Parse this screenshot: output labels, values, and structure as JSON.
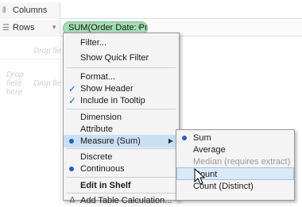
{
  "shelves": {
    "columns_label": "Columns",
    "rows_label": "Rows",
    "columns_icon": "columns-icon",
    "rows_icon": "rows-icon",
    "pill_label": "SUM(Order Date: Pr..",
    "pill_color": "#a6dcb6"
  },
  "view": {
    "drop_field_top": "Drop fie",
    "drop_field_left_1": "Drop",
    "drop_field_left_2": "field",
    "drop_field_left_3": "here",
    "drop_field_mid": "Drop fie"
  },
  "context_menu": {
    "items": [
      {
        "label": "Filter..."
      },
      {
        "label": "Show Quick Filter"
      },
      {
        "label": "Format..."
      },
      {
        "label": "Show Header",
        "checked": true
      },
      {
        "label": "Include in Tooltip",
        "checked": true
      },
      {
        "label": "Dimension"
      },
      {
        "label": "Attribute"
      },
      {
        "label": "Measure (Sum)",
        "selected": true,
        "submenu": true
      },
      {
        "label": "Discrete"
      },
      {
        "label": "Continuous",
        "selected": true
      },
      {
        "label": "Edit in Shelf",
        "bold": true
      },
      {
        "label": "Add Table Calculation..."
      }
    ],
    "check_mark": "✓"
  },
  "submenu": {
    "items": [
      {
        "label": "Sum",
        "selected": true
      },
      {
        "label": "Average"
      },
      {
        "label": "Median (requires extract)",
        "disabled": true
      },
      {
        "label": "Count",
        "highlighted": true
      },
      {
        "label": "Count (Distinct)"
      }
    ]
  },
  "colors": {
    "highlight": "#c9dff3",
    "radio_accent": "#1e62b0",
    "menu_bg": "#f4f4f4"
  }
}
